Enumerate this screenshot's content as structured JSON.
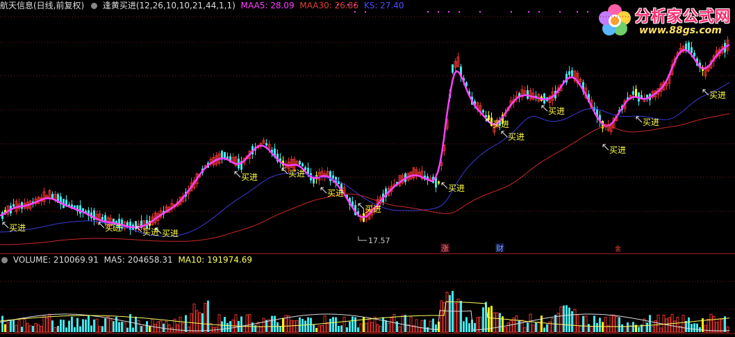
{
  "header": {
    "stock_name": "航天信息(日线,前复权)",
    "indicator_name": "逢黄买进(12,26,10,10,21,44,1,1)",
    "maa5_label": "MAA5: 28.09",
    "maa30_label": "MAA30: 26.86",
    "ks_label": "KS: 27.40"
  },
  "volume_header": {
    "volume_label": "VOLUME: 210069.91",
    "ma5_label": "MA5: 204658.31",
    "ma10_label": "MA10: 191974.69"
  },
  "signals": {
    "buy_label": "买进",
    "low_price_label": "17.57",
    "marker_zhang": "涨",
    "marker_cai": "财",
    "marker_jin": "金"
  },
  "logo": {
    "text": "分析家公式网",
    "url": "www.88gs.com"
  },
  "colors": {
    "background": "#000000",
    "up": "#e5342e",
    "down": "#43e6ec",
    "buy_bar": "#ffff00",
    "maa5": "#ff40ff",
    "maa30": "#d02828",
    "ks": "#3b3bd8",
    "buy_text": "#ffff40"
  }
}
